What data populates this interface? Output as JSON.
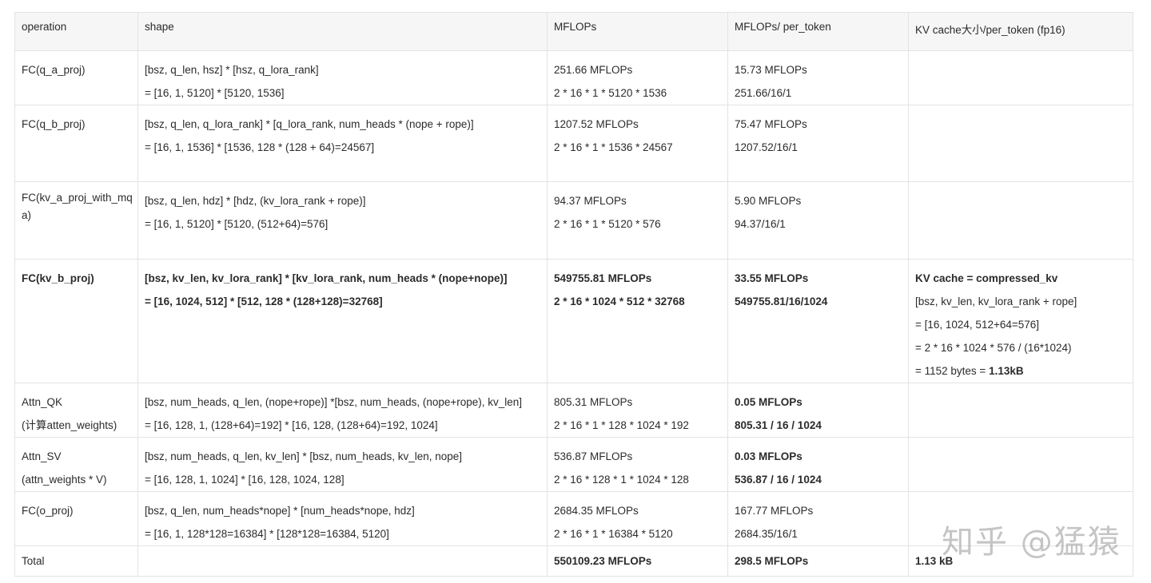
{
  "headers": [
    "operation",
    "shape",
    "MFLOPs",
    "MFLOPs/ per_token",
    "KV cache大小/per_token (fp16)"
  ],
  "rows": [
    {
      "op": [
        "FC(q_a_proj)"
      ],
      "shape": [
        "[bsz, q_len, hsz] * [hsz, q_lora_rank]",
        "= [16, 1, 5120] * [5120, 1536]"
      ],
      "mflops": [
        "251.66 MFLOPs",
        "2 * 16 * 1 * 5120 * 1536"
      ],
      "per_token": [
        "15.73 MFLOPs",
        "251.66/16/1"
      ],
      "kv": []
    },
    {
      "op": [
        "FC(q_b_proj)"
      ],
      "shape": [
        "[bsz, q_len, q_lora_rank] * [q_lora_rank, num_heads * (nope + rope)]",
        "= [16, 1, 1536] * [1536, 128 * (128 + 64)=24567]"
      ],
      "mflops": [
        "1207.52 MFLOPs",
        "2 * 16 * 1 * 1536 * 24567"
      ],
      "per_token": [
        "75.47 MFLOPs",
        "1207.52/16/1"
      ],
      "kv": []
    },
    {
      "op": [
        "FC(kv_a_proj_with_mq",
        "a)"
      ],
      "shape": [
        "[bsz, q_len, hdz] * [hdz, (kv_lora_rank + rope)]",
        "= [16, 1, 5120] * [5120, (512+64)=576]"
      ],
      "mflops": [
        "94.37 MFLOPs",
        "2 * 16 * 1 * 5120 * 576"
      ],
      "per_token": [
        "5.90 MFLOPs",
        "94.37/16/1"
      ],
      "kv": []
    },
    {
      "op": [
        "FC(kv_b_proj)"
      ],
      "shape": [
        "[bsz, kv_len, kv_lora_rank] * [kv_lora_rank, num_heads * (nope+nope)]",
        "= [16, 1024, 512] * [512, 128 * (128+128)=32768]"
      ],
      "mflops": [
        "549755.81 MFLOPs",
        "2 * 16 * 1024 * 512 * 32768"
      ],
      "per_token": [
        "33.55 MFLOPs",
        "549755.81/16/1024"
      ],
      "kv_title": "KV cache = compressed_kv",
      "kv": [
        "[bsz, kv_len, kv_lora_rank + rope]",
        "= [16, 1024, 512+64=576]",
        "= 2 * 16 * 1024 * 576 / (16*1024)"
      ],
      "kv_last_prefix": "= 1152 bytes = ",
      "kv_last_bold": "1.13kB"
    },
    {
      "op": [
        "Attn_QK",
        "(计算atten_weights)"
      ],
      "shape": [
        "[bsz, num_heads, q_len, (nope+rope)] *[bsz, num_heads, (nope+rope), kv_len]",
        "= [16, 128, 1, (128+64)=192] * [16, 128, (128+64)=192, 1024]"
      ],
      "mflops": [
        "805.31 MFLOPs",
        "2 * 16 * 1 * 128 * 1024 * 192"
      ],
      "per_token": [
        "0.05 MFLOPs",
        "805.31 / 16 / 1024"
      ],
      "kv": []
    },
    {
      "op": [
        "Attn_SV",
        "(attn_weights * V)"
      ],
      "shape": [
        "[bsz, num_heads, q_len, kv_len] * [bsz, num_heads, kv_len, nope]",
        "= [16, 128, 1, 1024] * [16, 128, 1024, 128]"
      ],
      "mflops": [
        "536.87 MFLOPs",
        "2 * 16 * 128 * 1 * 1024 * 128"
      ],
      "per_token": [
        "0.03 MFLOPs",
        "536.87 / 16 / 1024"
      ],
      "kv": []
    },
    {
      "op": [
        "FC(o_proj)"
      ],
      "shape": [
        "[bsz, q_len, num_heads*nope] * [num_heads*nope, hdz]",
        "= [16, 1, 128*128=16384] * [128*128=16384, 5120]"
      ],
      "mflops": [
        "2684.35 MFLOPs",
        "2 * 16 * 1 * 16384 * 5120"
      ],
      "per_token": [
        "167.77 MFLOPs",
        "2684.35/16/1"
      ],
      "kv": []
    }
  ],
  "total": {
    "label": "Total",
    "shape": "",
    "mflops": "550109.23 MFLOPs",
    "per_token": "298.5 MFLOPs",
    "kv": "1.13 kB"
  },
  "watermark": "知乎 @猛猿"
}
